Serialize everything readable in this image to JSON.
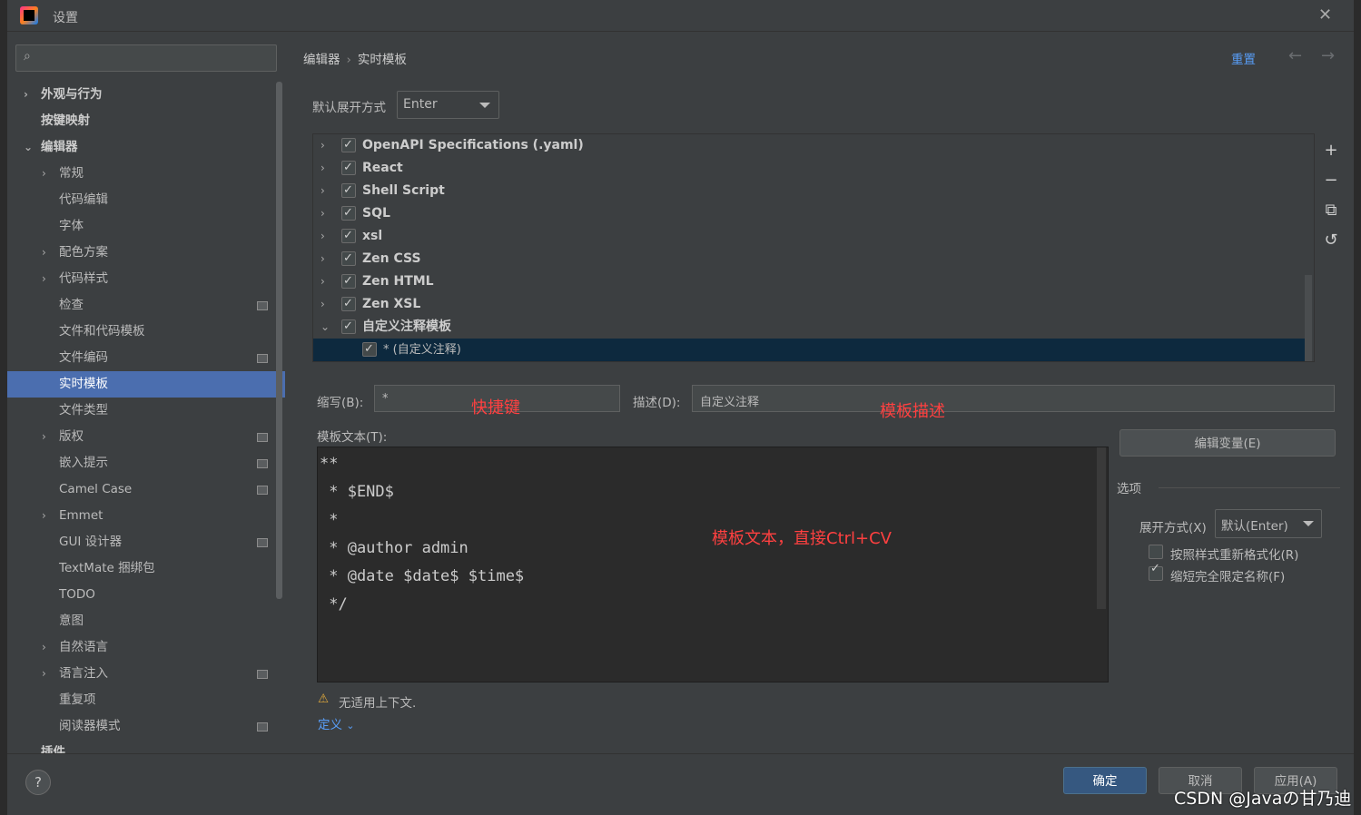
{
  "window": {
    "title": "设置",
    "close_icon": "✕"
  },
  "sidebar": {
    "search_placeholder": "",
    "items": [
      {
        "label": "外观与行为",
        "arrow": "›",
        "bold": true
      },
      {
        "label": "按键映射",
        "arrow": "",
        "bold": true
      },
      {
        "label": "编辑器",
        "arrow": "⌄",
        "bold": true
      },
      {
        "label": "常规",
        "arrow": "›"
      },
      {
        "label": "代码编辑",
        "arrow": ""
      },
      {
        "label": "字体",
        "arrow": ""
      },
      {
        "label": "配色方案",
        "arrow": "›"
      },
      {
        "label": "代码样式",
        "arrow": "›"
      },
      {
        "label": "检查",
        "arrow": "",
        "proj": true
      },
      {
        "label": "文件和代码模板",
        "arrow": ""
      },
      {
        "label": "文件编码",
        "arrow": "",
        "proj": true
      },
      {
        "label": "实时模板",
        "arrow": "",
        "selected": true
      },
      {
        "label": "文件类型",
        "arrow": ""
      },
      {
        "label": "版权",
        "arrow": "›",
        "proj": true
      },
      {
        "label": "嵌入提示",
        "arrow": "",
        "proj": true
      },
      {
        "label": "Camel Case",
        "arrow": "",
        "proj": true
      },
      {
        "label": "Emmet",
        "arrow": "›"
      },
      {
        "label": "GUI 设计器",
        "arrow": "",
        "proj": true
      },
      {
        "label": "TextMate 捆绑包",
        "arrow": ""
      },
      {
        "label": "TODO",
        "arrow": ""
      },
      {
        "label": "意图",
        "arrow": ""
      },
      {
        "label": "自然语言",
        "arrow": "›"
      },
      {
        "label": "语言注入",
        "arrow": "›",
        "proj": true
      },
      {
        "label": "重复项",
        "arrow": ""
      },
      {
        "label": "阅读器模式",
        "arrow": "",
        "proj": true
      },
      {
        "label": "插件",
        "arrow": "",
        "bold": true
      }
    ]
  },
  "breadcrumb": {
    "parent": "编辑器",
    "sep": "›",
    "current": "实时模板"
  },
  "header": {
    "reset": "重置",
    "back_icon": "←",
    "forward_icon": "→"
  },
  "expand": {
    "label": "默认展开方式",
    "value": "Enter"
  },
  "templates": [
    {
      "name": "OpenAPI Specifications (.yaml)",
      "arrow": "›"
    },
    {
      "name": "React",
      "arrow": "›"
    },
    {
      "name": "Shell Script",
      "arrow": "›"
    },
    {
      "name": "SQL",
      "arrow": "›"
    },
    {
      "name": "xsl",
      "arrow": "›"
    },
    {
      "name": "Zen CSS",
      "arrow": "›"
    },
    {
      "name": "Zen HTML",
      "arrow": "›"
    },
    {
      "name": "Zen XSL",
      "arrow": "›"
    },
    {
      "name": "自定义注释模板",
      "arrow": "⌄"
    },
    {
      "name": "* (自定义注释)",
      "arrow": "",
      "child": true
    }
  ],
  "tools": {
    "add": "+",
    "remove": "−",
    "copy": "⧉",
    "revert": "↺"
  },
  "abbrev": {
    "label": "缩写(B):",
    "value": "*",
    "annotation": "快捷键"
  },
  "desc": {
    "label": "描述(D):",
    "value": "自定义注释",
    "annotation": "模板描述"
  },
  "template_text": {
    "label": "模板文本(T):",
    "lines": [
      "**",
      " * $END$",
      " *",
      " * @author admin",
      " * @date $date$ $time$",
      " */"
    ],
    "annotation": "模板文本，直接Ctrl+CV"
  },
  "edit_vars": "编辑变量(E)",
  "options": {
    "title": "选项",
    "expand_label": "展开方式(X)",
    "expand_value": "默认(Enter)",
    "reformat": "按照样式重新格式化(R)",
    "shorten": "缩短完全限定名称(F)"
  },
  "warning": {
    "icon": "⚠",
    "text": "无适用上下文.",
    "define": "定义"
  },
  "footer": {
    "help": "?",
    "ok": "确定",
    "cancel": "取消",
    "apply": "应用(A)",
    "watermark": "CSDN @Javaの甘乃迪"
  }
}
